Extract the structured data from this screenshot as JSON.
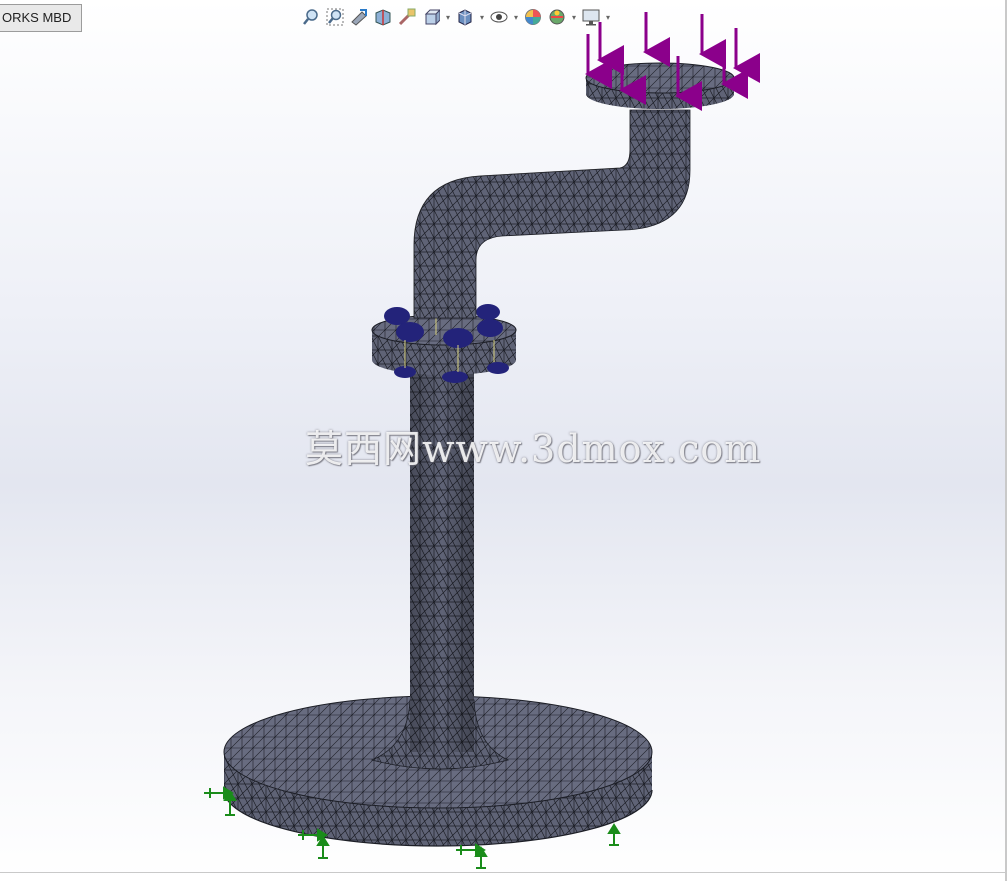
{
  "tab": {
    "label": "ORKS MBD"
  },
  "toolbar": {
    "buttons": [
      {
        "name": "zoom-to-fit-icon"
      },
      {
        "name": "zoom-to-area-icon"
      },
      {
        "name": "previous-view-icon"
      },
      {
        "name": "section-view-icon"
      },
      {
        "name": "dynamic-annotation-icon"
      },
      {
        "name": "view-orientation-icon",
        "dropdown": true
      },
      {
        "name": "display-style-icon",
        "dropdown": true
      },
      {
        "name": "hide-show-items-icon",
        "dropdown": true
      },
      {
        "name": "edit-appearance-icon"
      },
      {
        "name": "apply-scene-icon",
        "dropdown": true
      },
      {
        "name": "view-settings-icon",
        "dropdown": true
      }
    ]
  },
  "watermark": {
    "text": "莫西网www.3dmox.com"
  },
  "colors": {
    "mesh": "#5d6173",
    "mesh_lines": "#1c1e26",
    "load_arrow": "#8b008b",
    "fixture": "#1a8c1a",
    "bolt": "#23237a"
  }
}
